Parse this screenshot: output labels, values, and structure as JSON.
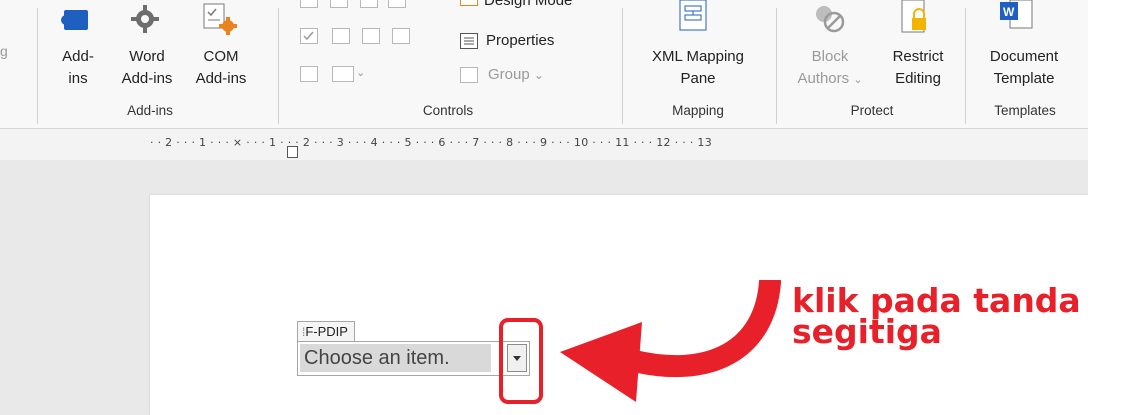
{
  "ribbon": {
    "addins_group": {
      "label": "Add-ins",
      "buttons": [
        {
          "name": "add-ins",
          "line1": "Add-",
          "line2": "ins"
        },
        {
          "name": "word-add-ins",
          "line1": "Word",
          "line2": "Add-ins"
        },
        {
          "name": "com-add-ins",
          "line1": "COM",
          "line2": "Add-ins"
        }
      ]
    },
    "controls_group": {
      "label": "Controls",
      "design_mode": "Design Mode",
      "properties": "Properties",
      "group": "Group"
    },
    "mapping_group": {
      "label": "Mapping",
      "xml_line1": "XML Mapping",
      "xml_line2": "Pane"
    },
    "protect_group": {
      "label": "Protect",
      "block_line1": "Block",
      "block_line2": "Authors",
      "restrict_line1": "Restrict",
      "restrict_line2": "Editing"
    },
    "templates_group": {
      "label": "Templates",
      "doc_line1": "Document",
      "doc_line2": "Template"
    }
  },
  "ruler": {
    "text": "· · 2 · · · 1 · · · ⨯ · · · 1 · · · 2 · · · 3 · · · 4 · · · 5 · · · 6 · · · 7 · · · 8 · · · 9 · · · 10 · · · 11 · · · 12 · · · 13"
  },
  "document": {
    "content_control": {
      "tag": "F-PDIP",
      "placeholder": "Choose an item."
    }
  },
  "annotation": {
    "line1": "klik pada tanda",
    "line2": "segitiga"
  },
  "colors": {
    "annotation_red": "#e8202a",
    "word_blue": "#1f5fbf",
    "addins_orange": "#e8831e"
  }
}
